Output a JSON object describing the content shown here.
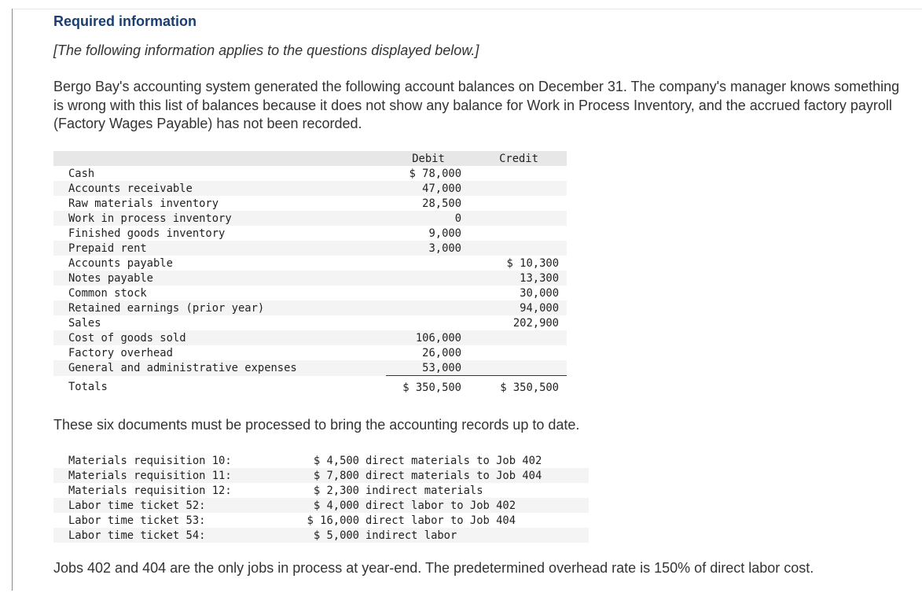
{
  "header": {
    "title": "Required information",
    "subtitle": "[The following information applies to the questions displayed below.]"
  },
  "intro": "Bergo Bay's accounting system generated the following account balances on December 31. The company's manager knows something is wrong with this list of balances because it does not show any balance for Work in Process Inventory, and the accrued factory payroll (Factory Wages Payable) has not been recorded.",
  "balances": {
    "columns": {
      "debit": "Debit",
      "credit": "Credit"
    },
    "rows": [
      {
        "account": "Cash",
        "debit": "$ 78,000",
        "credit": ""
      },
      {
        "account": "Accounts receivable",
        "debit": "47,000",
        "credit": ""
      },
      {
        "account": "Raw materials inventory",
        "debit": "28,500",
        "credit": ""
      },
      {
        "account": "Work in process inventory",
        "debit": "0",
        "credit": ""
      },
      {
        "account": "Finished goods inventory",
        "debit": "9,000",
        "credit": ""
      },
      {
        "account": "Prepaid rent",
        "debit": "3,000",
        "credit": ""
      },
      {
        "account": "Accounts payable",
        "debit": "",
        "credit": "$ 10,300"
      },
      {
        "account": "Notes payable",
        "debit": "",
        "credit": "13,300"
      },
      {
        "account": "Common stock",
        "debit": "",
        "credit": "30,000"
      },
      {
        "account": "Retained earnings (prior year)",
        "debit": "",
        "credit": "94,000"
      },
      {
        "account": "Sales",
        "debit": "",
        "credit": "202,900"
      },
      {
        "account": "Cost of goods sold",
        "debit": "106,000",
        "credit": ""
      },
      {
        "account": "Factory overhead",
        "debit": "26,000",
        "credit": ""
      },
      {
        "account": "General and administrative expenses",
        "debit": "53,000",
        "credit": ""
      }
    ],
    "totals": {
      "label": "Totals",
      "debit": "$ 350,500",
      "credit": "$ 350,500"
    }
  },
  "documents_intro": "These six documents must be processed to bring the accounting records up to date.",
  "documents": [
    {
      "name": "Materials requisition 10:",
      "amount": "$ 4,500",
      "desc": "direct materials to Job 402"
    },
    {
      "name": "Materials requisition 11:",
      "amount": "$ 7,800",
      "desc": "direct materials to Job 404"
    },
    {
      "name": "Materials requisition 12:",
      "amount": "$ 2,300",
      "desc": "indirect materials"
    },
    {
      "name": "Labor time ticket 52:",
      "amount": "$ 4,000",
      "desc": "direct labor to Job 402"
    },
    {
      "name": "Labor time ticket 53:",
      "amount": "$ 16,000",
      "desc": "direct labor to Job 404"
    },
    {
      "name": "Labor time ticket 54:",
      "amount": "$ 5,000",
      "desc": "indirect labor"
    }
  ],
  "closing": "Jobs 402 and 404 are the only jobs in process at year-end. The predetermined overhead rate is 150% of direct labor cost."
}
